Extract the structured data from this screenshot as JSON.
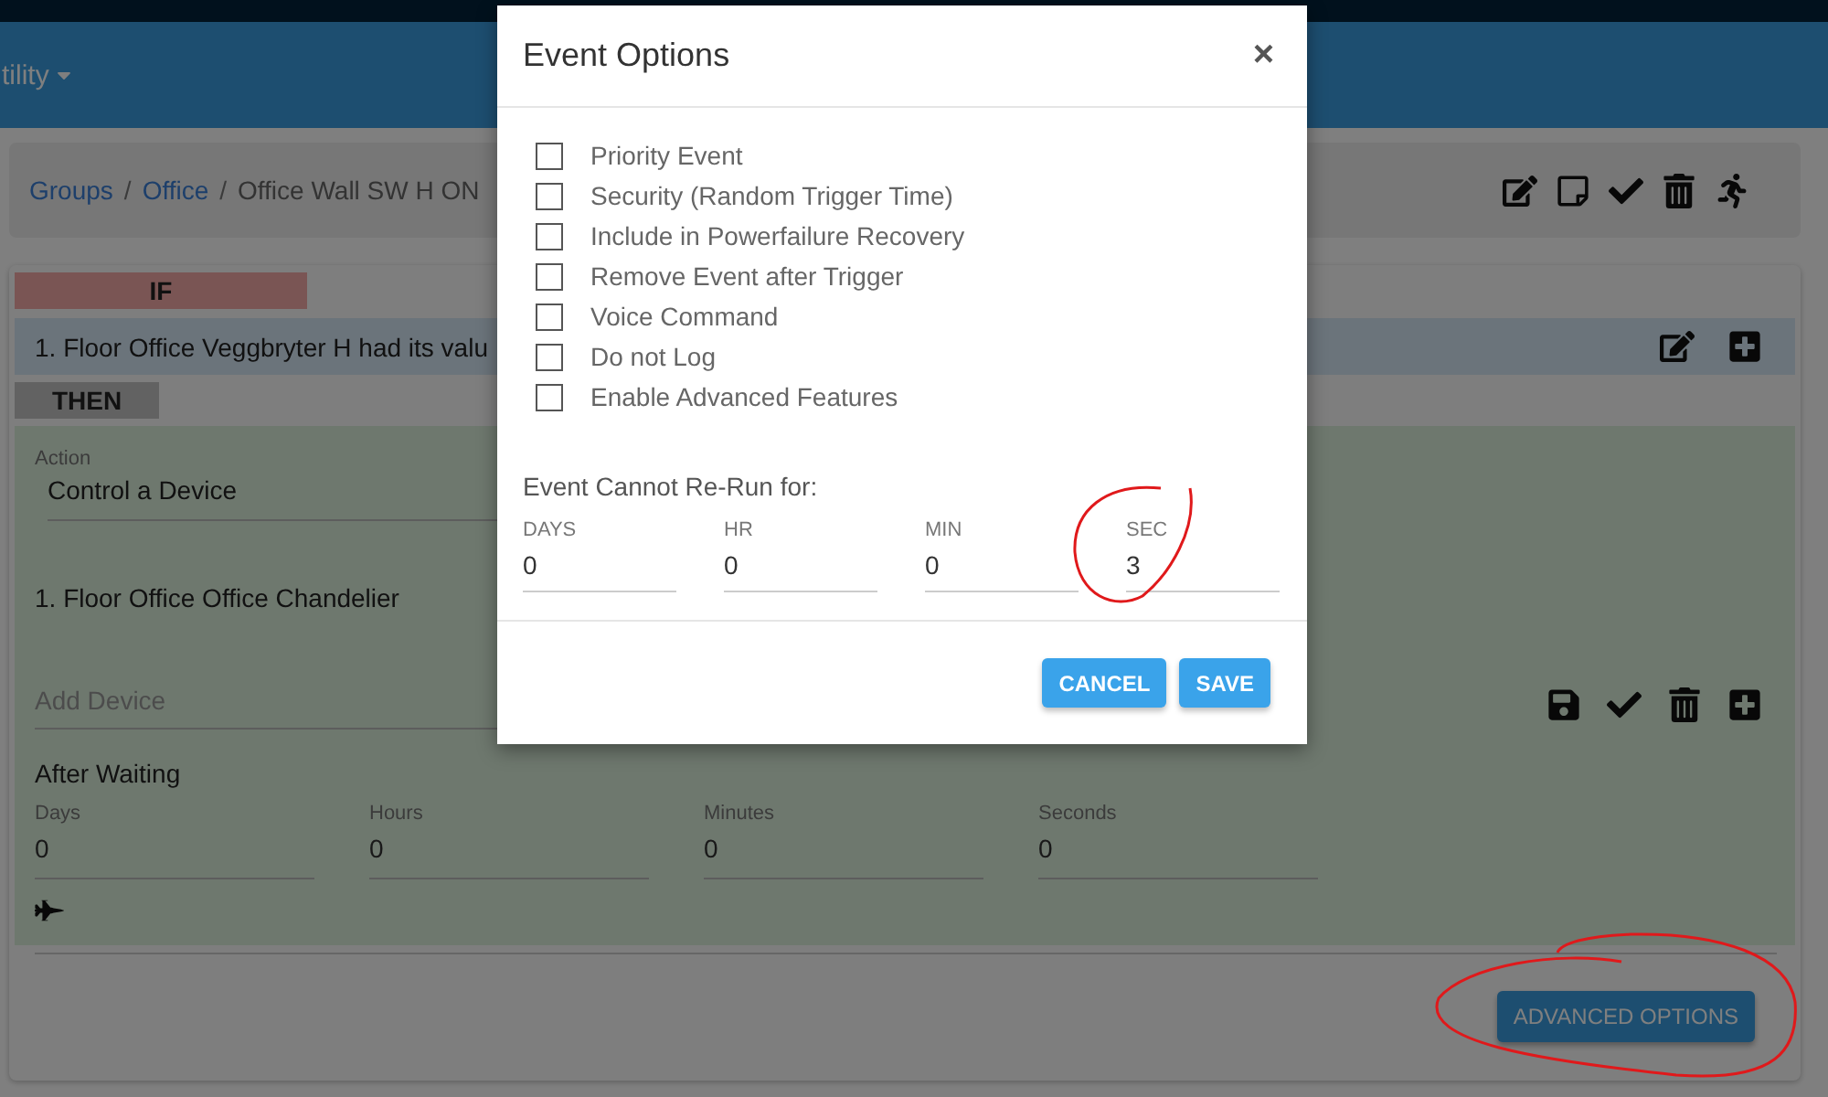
{
  "navbar": {
    "menu": "tility"
  },
  "breadcrumb": {
    "links": [
      "Groups",
      "Office"
    ],
    "separator": "/",
    "current": "Office Wall SW H ON"
  },
  "if_block": {
    "label": "IF",
    "conditions": [
      "1. Floor Office Veggbryter H had its valu"
    ]
  },
  "then_block": {
    "label": "THEN",
    "action_label": "Action",
    "action": "Control a Device",
    "devices": [
      "1. Floor Office Office Chandelier"
    ],
    "add_device_placeholder": "Add Device",
    "wait_title": "After Waiting",
    "wait_fields": [
      {
        "label": "Days",
        "value": "0"
      },
      {
        "label": "Hours",
        "value": "0"
      },
      {
        "label": "Minutes",
        "value": "0"
      },
      {
        "label": "Seconds",
        "value": "0"
      }
    ]
  },
  "advanced_button": "ADVANCED OPTIONS",
  "modal": {
    "title": "Event Options",
    "close": "×",
    "options": [
      {
        "label": "Priority Event",
        "checked": false
      },
      {
        "label": "Security (Random Trigger Time)",
        "checked": false
      },
      {
        "label": "Include in Powerfailure Recovery",
        "checked": false
      },
      {
        "label": "Remove Event after Trigger",
        "checked": false
      },
      {
        "label": "Voice Command",
        "checked": false
      },
      {
        "label": "Do not Log",
        "checked": false
      },
      {
        "label": "Enable Advanced Features",
        "checked": false
      }
    ],
    "rerun_title": "Event Cannot Re-Run for:",
    "rerun_fields": [
      {
        "label": "DAYS",
        "value": "0"
      },
      {
        "label": "HR",
        "value": "0"
      },
      {
        "label": "MIN",
        "value": "0"
      },
      {
        "label": "SEC",
        "value": "3"
      }
    ],
    "buttons": [
      "CANCEL",
      "SAVE"
    ]
  }
}
